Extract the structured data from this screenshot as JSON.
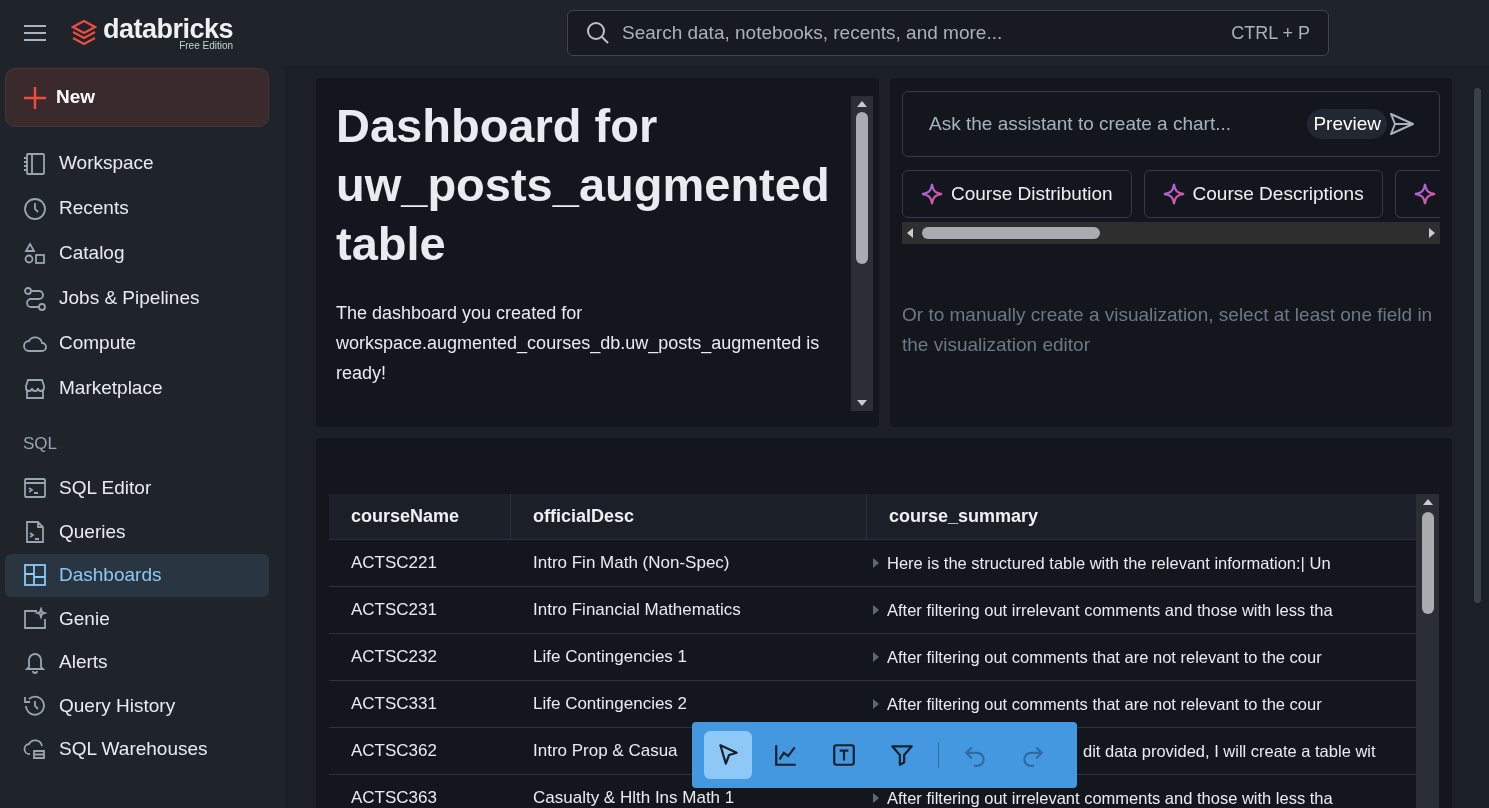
{
  "app": {
    "brand": "databricks",
    "edition": "Free Edition"
  },
  "search": {
    "placeholder": "Search data, notebooks, recents, and more...",
    "shortcut": "CTRL + P"
  },
  "sidebar": {
    "new_button": "New",
    "groups": [
      {
        "items": [
          {
            "label": "Workspace",
            "selected": false
          },
          {
            "label": "Recents",
            "selected": false
          },
          {
            "label": "Catalog",
            "selected": false
          },
          {
            "label": "Jobs & Pipelines",
            "selected": false
          },
          {
            "label": "Compute",
            "selected": false
          },
          {
            "label": "Marketplace",
            "selected": false
          }
        ]
      },
      {
        "heading": "SQL",
        "items": [
          {
            "label": "SQL Editor",
            "selected": false
          },
          {
            "label": "Queries",
            "selected": false
          },
          {
            "label": "Dashboards",
            "selected": true
          },
          {
            "label": "Genie",
            "selected": false
          },
          {
            "label": "Alerts",
            "selected": false
          },
          {
            "label": "Query History",
            "selected": false
          },
          {
            "label": "SQL Warehouses",
            "selected": false
          }
        ]
      }
    ]
  },
  "text_widget": {
    "title": "Dashboard for uw_posts_augmented table",
    "body": "The dashboard you created for workspace.augmented_courses_db.uw_posts_augmented is ready!"
  },
  "assistant": {
    "placeholder": "Ask the assistant to create a chart...",
    "badge": "Preview",
    "suggestions": [
      "Course Distribution",
      "Course Descriptions"
    ],
    "hint": "Or to manually create a visualization, select at least one field in the visualization editor"
  },
  "table": {
    "columns": [
      "courseName",
      "officialDesc",
      "course_summary"
    ],
    "rows": [
      [
        "ACTSC221",
        "Intro Fin Math (Non-Spec)",
        "Here is the structured table with the relevant information:| Un"
      ],
      [
        "ACTSC231",
        "Intro Financial Mathematics",
        "After filtering out irrelevant comments and those with less tha"
      ],
      [
        "ACTSC232",
        "Life Contingencies 1",
        "After filtering out comments that are not relevant to the cour"
      ],
      [
        "ACTSC331",
        "Life Contingencies 2",
        "After filtering out comments that are not relevant to the cour"
      ],
      [
        "ACTSC362",
        "Intro Prop & Casua",
        "dit data provided, I will create a table wit"
      ],
      [
        "ACTSC363",
        "Casualty & Hlth Ins Math 1",
        "After filtering out irrelevant comments and those with less tha"
      ]
    ]
  },
  "toolbar": {
    "tools": [
      {
        "selected": true
      },
      {
        "selected": false
      },
      {
        "selected": false
      },
      {
        "selected": false
      }
    ],
    "history": [
      {
        "disabled": true
      },
      {
        "disabled": true
      }
    ]
  }
}
